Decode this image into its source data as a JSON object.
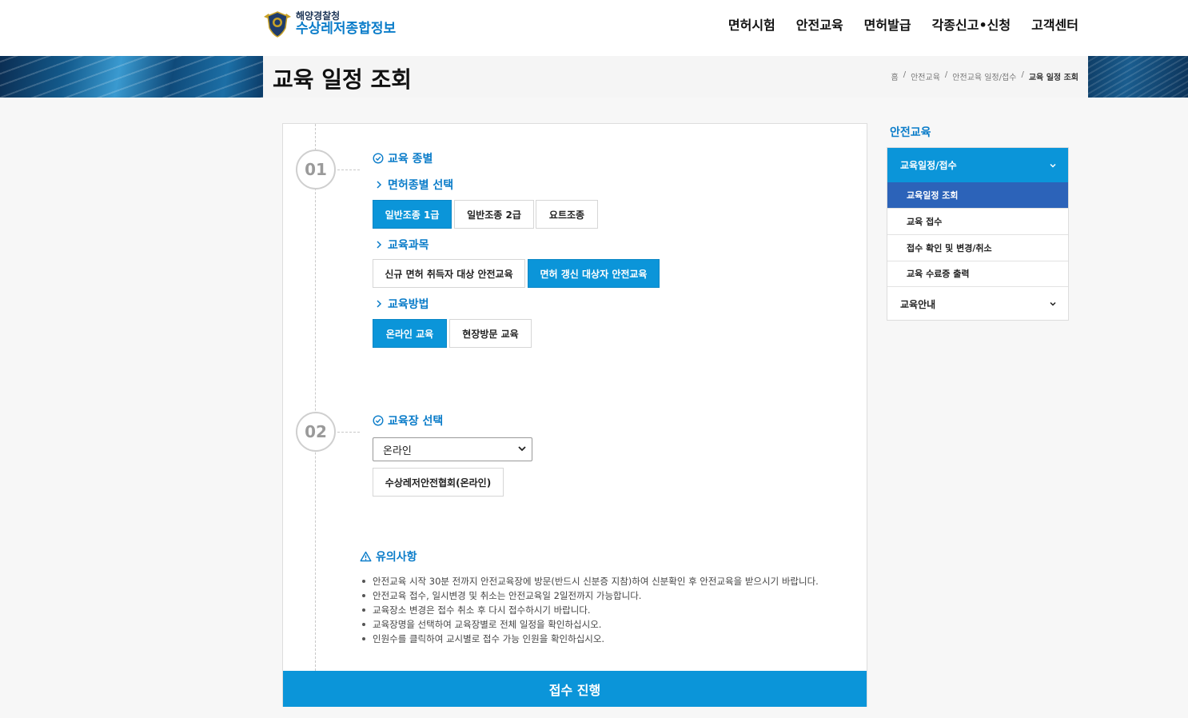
{
  "header": {
    "org_name": "해양경찰청",
    "service_name": "수상레저종합정보",
    "nav": [
      "면허시험",
      "안전교육",
      "면허발급",
      "각종신고•신청",
      "고객센터"
    ]
  },
  "page": {
    "title": "교육 일정 조회",
    "breadcrumb": [
      "홈",
      "안전교육",
      "안전교육 일정/접수",
      "교육 일정 조회"
    ]
  },
  "step1": {
    "number": "01",
    "title": "교육 종별",
    "license_type_label": "면허종별 선택",
    "license_types": [
      "일반조종 1급",
      "일반조종 2급",
      "요트조종"
    ],
    "course_label": "교육과목",
    "courses": [
      "신규 면허 취득자 대상 안전교육",
      "면허 갱신 대상자 안전교육"
    ],
    "method_label": "교육방법",
    "methods": [
      "온라인 교육",
      "현장방문 교육"
    ]
  },
  "step2": {
    "number": "02",
    "title": "교육장 선택",
    "select_value": "온라인",
    "venue": "수상레저안전협회(온라인)"
  },
  "notice": {
    "title": "유의사항",
    "items": [
      "안전교육 시작 30분 전까지 안전교육장에 방문(반드시 신분증 지참)하여 신분확인 후 안전교육을 받으시기 바랍니다.",
      "안전교육 접수, 일시변경 및 취소는 안전교육일 2일전까지 가능합니다.",
      "교육장소 변경은 접수 취소 후 다시 접수하시기 바랍니다.",
      "교육장명을 선택하여 교육장별로 전체 일정을 확인하십시오.",
      "인원수를 클릭하여 교시별로 접수 가능 인원을 확인하십시오."
    ]
  },
  "submit_label": "접수 진행",
  "sidebar": {
    "title": "안전교육",
    "group1": "교육일정/접수",
    "items": [
      "교육일정 조회",
      "교육 접수",
      "접수 확인 및 변경/취소",
      "교육 수료증 출력"
    ],
    "group2": "교육안내"
  },
  "colors": {
    "accent": "#0b95d9",
    "accent_text": "#0a7cc9",
    "active_menu": "#2c63b9"
  }
}
